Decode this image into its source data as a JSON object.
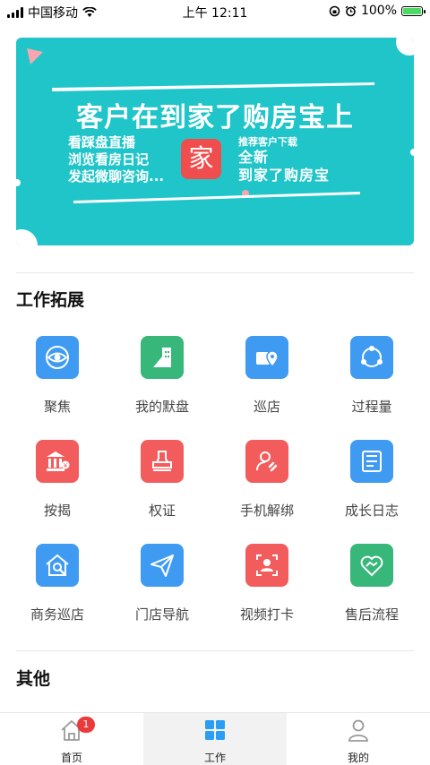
{
  "status_bar": {
    "carrier": "中国移动",
    "time": "上午 12:11",
    "battery": "100%"
  },
  "banner": {
    "title": "客户在到家了购房宝上",
    "lines": [
      "看踩盘直播",
      "浏览看房日记",
      "发起微聊咨询..."
    ],
    "logo": "家",
    "recommend_small": "推荐客户下载",
    "recommend_line1": "全新",
    "recommend_line2": "到家了购房宝"
  },
  "work_section": {
    "title": "工作拓展",
    "items": [
      {
        "label": "聚焦",
        "icon": "eye-icon",
        "color": "#3f9bf2"
      },
      {
        "label": "我的默盘",
        "icon": "building-icon",
        "color": "#37b77a"
      },
      {
        "label": "巡店",
        "icon": "store-location-icon",
        "color": "#3f9bf2"
      },
      {
        "label": "过程量",
        "icon": "cycle-icon",
        "color": "#3f9bf2"
      },
      {
        "label": "按揭",
        "icon": "bank-icon",
        "color": "#f25c5c"
      },
      {
        "label": "权证",
        "icon": "stamp-icon",
        "color": "#f25c5c"
      },
      {
        "label": "手机解绑",
        "icon": "user-unlink-icon",
        "color": "#f25c5c"
      },
      {
        "label": "成长日志",
        "icon": "log-icon",
        "color": "#3f9bf2"
      },
      {
        "label": "商务巡店",
        "icon": "house-search-icon",
        "color": "#3f9bf2"
      },
      {
        "label": "门店导航",
        "icon": "paper-plane-icon",
        "color": "#3f9bf2"
      },
      {
        "label": "视频打卡",
        "icon": "face-scan-icon",
        "color": "#f25c5c"
      },
      {
        "label": "售后流程",
        "icon": "heart-handshake-icon",
        "color": "#37b77a"
      }
    ]
  },
  "other_section": {
    "title": "其他"
  },
  "tab_bar": {
    "home": {
      "label": "首页",
      "badge": "1"
    },
    "work": {
      "label": "工作"
    },
    "mine": {
      "label": "我的"
    }
  }
}
